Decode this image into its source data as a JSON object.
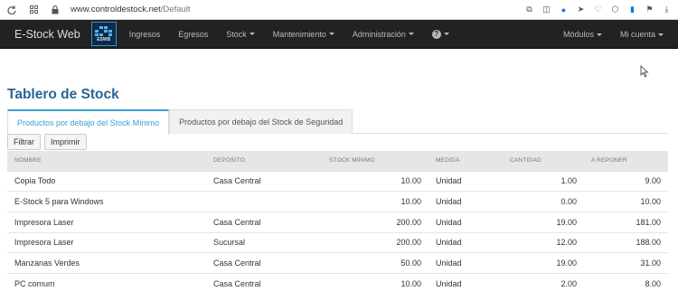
{
  "browser": {
    "url_domain": "www.controldestock.net",
    "url_path": "/Default"
  },
  "navbar": {
    "brand": "E-Stock Web",
    "logo_text": "ESWB",
    "items": [
      {
        "label": "Ingresos",
        "dropdown": false
      },
      {
        "label": "Egresos",
        "dropdown": false
      },
      {
        "label": "Stock",
        "dropdown": true
      },
      {
        "label": "Mantenimiento",
        "dropdown": true
      },
      {
        "label": "Administración",
        "dropdown": true
      }
    ],
    "help_icon": "question-circle-icon",
    "right_items": [
      {
        "label": "Módulos"
      },
      {
        "label": "Mi cuenta"
      }
    ]
  },
  "page": {
    "title": "Tablero de Stock",
    "tabs": [
      {
        "label": "Productos por debajo del Stock Mínimo",
        "active": true
      },
      {
        "label": "Productos por debajo del Stock de Seguridad",
        "active": false
      }
    ],
    "buttons": {
      "filter": "Filtrar",
      "print": "Imprimir"
    }
  },
  "table": {
    "headers": [
      "Nombre",
      "Depósito",
      "Stock Mínimo",
      "Medida",
      "Cantidad",
      "A Reponer"
    ],
    "rows": [
      [
        "Copia Todo",
        "Casa Central",
        "10.00",
        "Unidad",
        "1.00",
        "9.00"
      ],
      [
        "E-Stock 5 para Windows",
        "",
        "10.00",
        "Unidad",
        "0.00",
        "10.00"
      ],
      [
        "Impresora Laser",
        "Casa Central",
        "200.00",
        "Unidad",
        "19.00",
        "181.00"
      ],
      [
        "Impresora Laser",
        "Sucursal",
        "200.00",
        "Unidad",
        "12.00",
        "188.00"
      ],
      [
        "Manzanas Verdes",
        "Casa Central",
        "50.00",
        "Unidad",
        "19.00",
        "31.00"
      ],
      [
        "PC comum",
        "Casa Central",
        "10.00",
        "Unidad",
        "2.00",
        "8.00"
      ]
    ]
  },
  "colors": {
    "navbar_bg": "#222222",
    "title": "#2a6496",
    "active_tab": "#3aa0d0"
  }
}
